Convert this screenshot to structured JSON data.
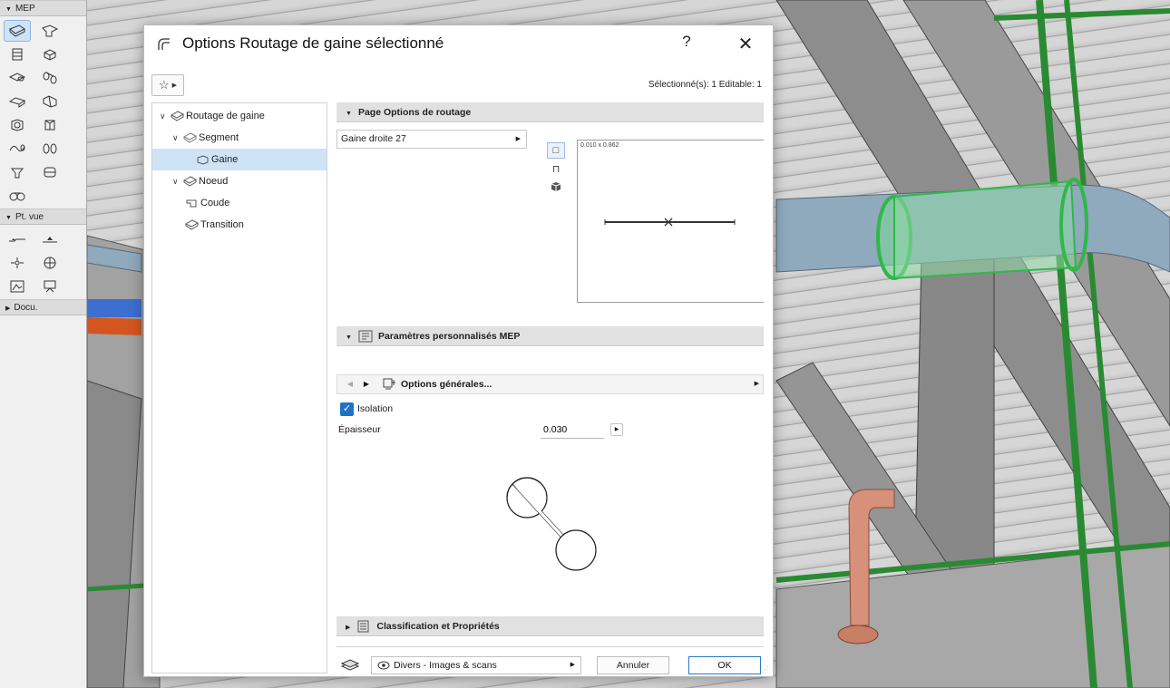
{
  "toolbox": {
    "sections": [
      {
        "label": "MEP",
        "expanded": true
      },
      {
        "label": "Pt. vue",
        "expanded": true
      },
      {
        "label": "Docu.",
        "expanded": false
      }
    ],
    "mep_tools": [
      "duct-segment-icon",
      "duct-bend-icon",
      "duct-terminal-icon",
      "duct-fitting-icon",
      "pipe-segment-icon",
      "pipe-bend-icon",
      "duct-elbow-icon",
      "duct-transition-icon",
      "equipment-icon",
      "fitting-icon",
      "pipe-flexible-icon",
      "pipe-transition-icon",
      "valve-icon",
      "tank-icon",
      "routing-icon"
    ],
    "view_tools": [
      "section-icon",
      "elevation-icon",
      "interior-elevation-icon",
      "worksheet-icon",
      "detail-icon",
      "camera-icon"
    ]
  },
  "dialog": {
    "title": "Options Routage de gaine sélectionné",
    "help_label": "?",
    "close_label": "✕",
    "favorites_label": "☆",
    "selection_info": "Sélectionné(s): 1 Editable: 1",
    "tree": {
      "root": "Routage de gaine",
      "segment": "Segment",
      "gaine": "Gaine",
      "noeud": "Noeud",
      "coude": "Coude",
      "transition": "Transition"
    },
    "routing_section": {
      "title": "Page Options de routage",
      "profile_value": "Gaine droite 27",
      "preview_dims": "0.010 x 0.862"
    },
    "mep_section": {
      "title": "Paramètres personnalisés MEP",
      "page_label": "Options générales...",
      "isolation_label": "Isolation",
      "isolation_checked": true,
      "thickness_label": "Épaisseur",
      "thickness_value": "0.030"
    },
    "classification_section": {
      "title": "Classification et Propriétés"
    },
    "footer": {
      "layer_value": "Divers - Images & scans",
      "cancel_label": "Annuler",
      "ok_label": "OK"
    }
  },
  "colors": {
    "accent": "#1f72c6",
    "selection": "#cfe3f7",
    "highlight_green": "#2fb84a",
    "duct_blue": "#8fa9bd",
    "pipe_orange": "#d7917a"
  }
}
